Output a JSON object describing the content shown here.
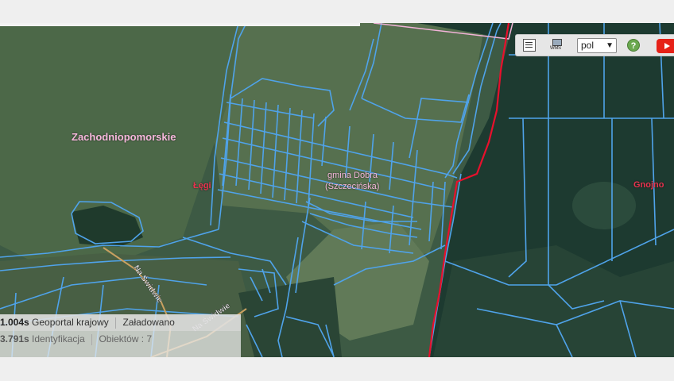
{
  "map": {
    "region_label": "Zachodniopomorskie",
    "commune_label_line1": "gmina Dobra",
    "commune_label_line2": "(Szczecińska)",
    "place_label": "Łęgi",
    "place_label_right": "Gnojno",
    "road_label_1": "Na Świdwie",
    "road_label_2": "Na Świdwie",
    "colors": {
      "parcel_boundary": "#4fa3ea",
      "admin_boundary": "#e8102c",
      "region_boundary": "#f2b3d8",
      "road": "#c8a060",
      "label_pink": "#f6b8dc",
      "label_red": "#e8334f"
    }
  },
  "toolbar": {
    "legend_icon": "legend-list-icon",
    "wms_icon": "wms-layer-icon",
    "wms_text": "WMS",
    "language_value": "pol",
    "help_icon": "help-question-icon",
    "help_glyph": "?",
    "youtube_icon": "youtube-icon"
  },
  "status": {
    "row1_time": "1.004s",
    "row1_source": "Geoportal krajowy",
    "row1_state": "Załadowano",
    "row2_time": "3.791s",
    "row2_action": "Identyfikacja",
    "row2_objects": "Obiektów : 7"
  }
}
